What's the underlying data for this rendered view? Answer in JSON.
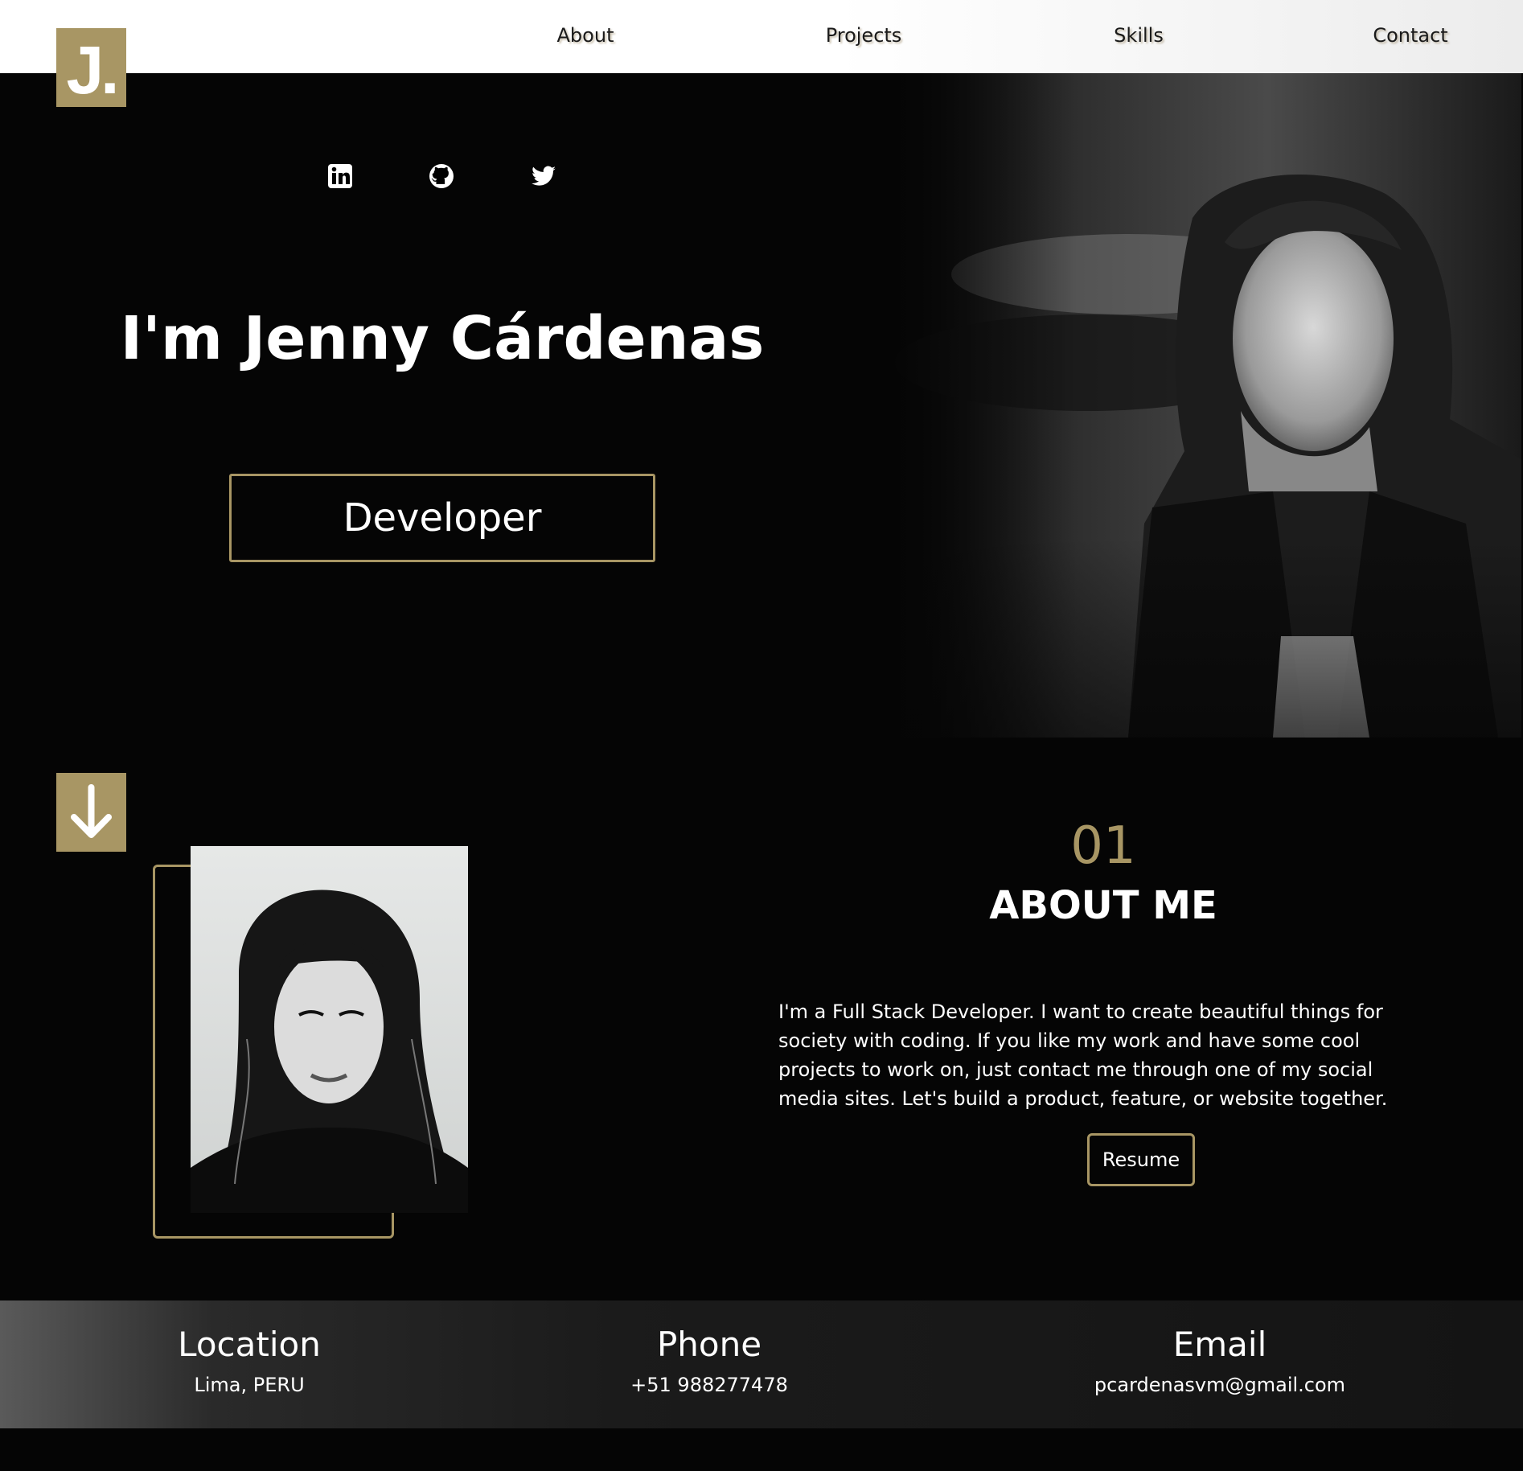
{
  "logo": {
    "text": "J."
  },
  "nav": {
    "items": [
      {
        "label": "About"
      },
      {
        "label": "Projects"
      },
      {
        "label": "Skills"
      },
      {
        "label": "Contact"
      }
    ]
  },
  "hero": {
    "socials": [
      "linkedin-icon",
      "github-icon",
      "twitter-icon"
    ],
    "name": "I'm Jenny Cárdenas",
    "role": "Developer"
  },
  "about": {
    "number": "01",
    "title": "ABOUT ME",
    "paragraph": "I'm a Full Stack Developer. I want to create beautiful things for society with coding. If you like my work and have some cool projects to work on, just contact me through one of my social media sites. Let's build a product, feature, or website together.",
    "resume_label": "Resume"
  },
  "contact_info": {
    "location": {
      "label": "Location",
      "value": "Lima, PERU"
    },
    "phone": {
      "label": "Phone",
      "value": "+51 988277478"
    },
    "email": {
      "label": "Email",
      "value": "pcardenasvm@gmail.com"
    }
  },
  "colors": {
    "accent": "#a89664",
    "background": "#050505",
    "nav_bg": "#ffffff"
  }
}
